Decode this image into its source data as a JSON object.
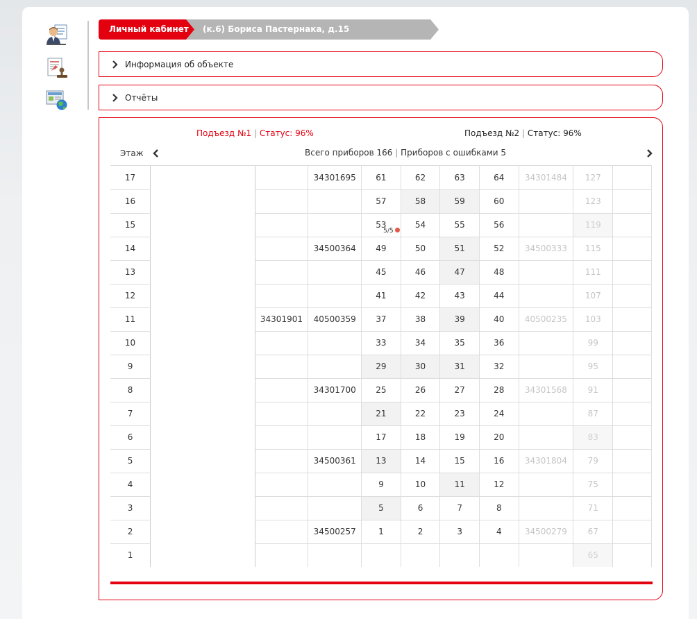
{
  "breadcrumbs": [
    "Личный кабинет",
    "(к.6) Бориса Пастернака, д.15"
  ],
  "panels": [
    {
      "title": "Информация об объекте"
    },
    {
      "title": "Отчёты"
    }
  ],
  "header": {
    "entrance1_label": "Подъезд №1",
    "entrance1_status": "Статус: 96%",
    "entrance2_label": "Подъезд №2",
    "entrance2_status": "Статус: 96%",
    "floor_header": "Этаж",
    "total_devices": "Всего приборов 166",
    "devices_errors": "Приборов с ошибками 5",
    "separator": "|"
  },
  "error_badge": "5/5",
  "floors": [
    {
      "floor": "17",
      "meter2": "",
      "meter3": "34301695",
      "apts": [
        "61",
        "62",
        "63",
        "64"
      ],
      "e2meter": "34301484",
      "e2apt": "127"
    },
    {
      "floor": "16",
      "meter2": "",
      "meter3": "",
      "apts": [
        "57",
        "58",
        "59",
        "60"
      ],
      "e2meter": "",
      "e2apt": "123"
    },
    {
      "floor": "15",
      "meter2": "",
      "meter3": "",
      "apts": [
        "53",
        "54",
        "55",
        "56"
      ],
      "e2meter": "",
      "e2apt": "119"
    },
    {
      "floor": "14",
      "meter2": "",
      "meter3": "34500364",
      "apts": [
        "49",
        "50",
        "51",
        "52"
      ],
      "e2meter": "34500333",
      "e2apt": "115"
    },
    {
      "floor": "13",
      "meter2": "",
      "meter3": "",
      "apts": [
        "45",
        "46",
        "47",
        "48"
      ],
      "e2meter": "",
      "e2apt": "111"
    },
    {
      "floor": "12",
      "meter2": "",
      "meter3": "",
      "apts": [
        "41",
        "42",
        "43",
        "44"
      ],
      "e2meter": "",
      "e2apt": "107"
    },
    {
      "floor": "11",
      "meter2": "34301901",
      "meter3": "40500359",
      "apts": [
        "37",
        "38",
        "39",
        "40"
      ],
      "e2meter": "40500235",
      "e2apt": "103"
    },
    {
      "floor": "10",
      "meter2": "",
      "meter3": "",
      "apts": [
        "33",
        "34",
        "35",
        "36"
      ],
      "e2meter": "",
      "e2apt": "99"
    },
    {
      "floor": "9",
      "meter2": "",
      "meter3": "",
      "apts": [
        "29",
        "30",
        "31",
        "32"
      ],
      "e2meter": "",
      "e2apt": "95"
    },
    {
      "floor": "8",
      "meter2": "",
      "meter3": "34301700",
      "apts": [
        "25",
        "26",
        "27",
        "28"
      ],
      "e2meter": "34301568",
      "e2apt": "91"
    },
    {
      "floor": "7",
      "meter2": "",
      "meter3": "",
      "apts": [
        "21",
        "22",
        "23",
        "24"
      ],
      "e2meter": "",
      "e2apt": "87"
    },
    {
      "floor": "6",
      "meter2": "",
      "meter3": "",
      "apts": [
        "17",
        "18",
        "19",
        "20"
      ],
      "e2meter": "",
      "e2apt": "83"
    },
    {
      "floor": "5",
      "meter2": "",
      "meter3": "34500361",
      "apts": [
        "13",
        "14",
        "15",
        "16"
      ],
      "e2meter": "34301804",
      "e2apt": "79"
    },
    {
      "floor": "4",
      "meter2": "",
      "meter3": "",
      "apts": [
        "9",
        "10",
        "11",
        "12"
      ],
      "e2meter": "",
      "e2apt": "75"
    },
    {
      "floor": "3",
      "meter2": "",
      "meter3": "",
      "apts": [
        "5",
        "6",
        "7",
        "8"
      ],
      "e2meter": "",
      "e2apt": "71"
    },
    {
      "floor": "2",
      "meter2": "",
      "meter3": "34500257",
      "apts": [
        "1",
        "2",
        "3",
        "4"
      ],
      "e2meter": "34500279",
      "e2apt": "67"
    },
    {
      "floor": "1",
      "meter2": "",
      "meter3": "",
      "apts": [
        "",
        "",
        "",
        ""
      ],
      "e2meter": "",
      "e2apt": "65"
    }
  ],
  "shaded_apartments": [
    "58",
    "59",
    "51",
    "47",
    "39",
    "29",
    "30",
    "31",
    "21",
    "13",
    "11",
    "5"
  ],
  "shaded_e2apts": [
    "119",
    "83",
    "65"
  ],
  "colors": {
    "accent": "#e3000f",
    "shade": "#f2f2f2",
    "faded": "#c5c5c5"
  },
  "icons": [
    "user-profile-icon",
    "document-stamp-icon",
    "globe-monitor-icon",
    "chevron-right-icon",
    "chevron-left-icon",
    "error-dot-icon"
  ]
}
